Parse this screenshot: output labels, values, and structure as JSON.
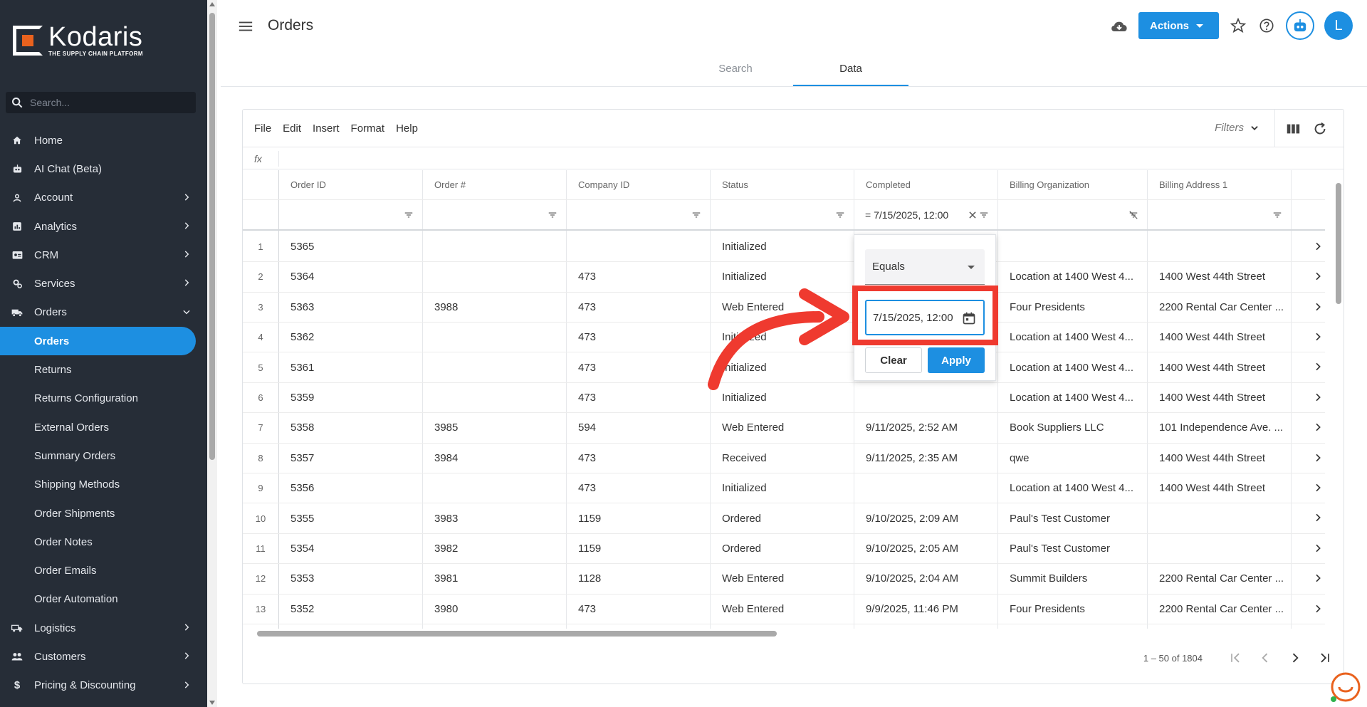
{
  "brand": {
    "name": "Kodaris",
    "tagline": "THE SUPPLY CHAIN PLATFORM"
  },
  "sidebar": {
    "search_placeholder": "Search...",
    "items": [
      {
        "label": "Home",
        "icon": "home-icon"
      },
      {
        "label": "AI Chat (Beta)",
        "icon": "robot-icon"
      },
      {
        "label": "Account",
        "icon": "person-icon",
        "expandable": true
      },
      {
        "label": "Analytics",
        "icon": "chart-icon",
        "expandable": true
      },
      {
        "label": "CRM",
        "icon": "id-card-icon",
        "expandable": true
      },
      {
        "label": "Services",
        "icon": "gears-icon",
        "expandable": true
      },
      {
        "label": "Orders",
        "icon": "truck-icon",
        "expanded": true
      }
    ],
    "sub_items": [
      "Orders",
      "Returns",
      "Returns Configuration",
      "External Orders",
      "Summary Orders",
      "Shipping Methods",
      "Order Shipments",
      "Order Notes",
      "Order Emails",
      "Order Automation"
    ],
    "active_sub": "Orders",
    "after_items": [
      {
        "label": "Logistics",
        "icon": "shipping-icon"
      },
      {
        "label": "Customers",
        "icon": "people-icon"
      },
      {
        "label": "Pricing & Discounting",
        "icon": "dollar-icon"
      }
    ]
  },
  "header": {
    "title": "Orders",
    "actions_label": "Actions",
    "avatar_letter": "L",
    "tabs": [
      {
        "label": "Search",
        "active": false
      },
      {
        "label": "Data",
        "active": true
      }
    ]
  },
  "toolbar": {
    "menus": [
      "File",
      "Edit",
      "Insert",
      "Format",
      "Help"
    ],
    "filters_label": "Filters",
    "fx_label": "fx"
  },
  "grid": {
    "columns": [
      "Order ID",
      "Order #",
      "Company ID",
      "Status",
      "Completed",
      "Billing Organization",
      "Billing Address 1"
    ],
    "completed_filter": "= 7/15/2025, 12:00",
    "rows": [
      {
        "n": "1",
        "id": "5365",
        "num": "",
        "company": "",
        "status": "Initialized",
        "completed": "",
        "org": "",
        "addr": ""
      },
      {
        "n": "2",
        "id": "5364",
        "num": "",
        "company": "473",
        "status": "Initialized",
        "completed": "",
        "org": "Location at 1400 West 4...",
        "addr": "1400 West 44th Street"
      },
      {
        "n": "3",
        "id": "5363",
        "num": "3988",
        "company": "473",
        "status": "Web Entered",
        "completed": "",
        "org": "Four Presidents",
        "addr": "2200 Rental Car Center ..."
      },
      {
        "n": "4",
        "id": "5362",
        "num": "",
        "company": "473",
        "status": "Initialized",
        "completed": "",
        "org": "Location at 1400 West 4...",
        "addr": "1400 West 44th Street"
      },
      {
        "n": "5",
        "id": "5361",
        "num": "",
        "company": "473",
        "status": "Initialized",
        "completed": "",
        "org": "Location at 1400 West 4...",
        "addr": "1400 West 44th Street"
      },
      {
        "n": "6",
        "id": "5359",
        "num": "",
        "company": "473",
        "status": "Initialized",
        "completed": "",
        "org": "Location at 1400 West 4...",
        "addr": "1400 West 44th Street"
      },
      {
        "n": "7",
        "id": "5358",
        "num": "3985",
        "company": "594",
        "status": "Web Entered",
        "completed": "9/11/2025, 2:52 AM",
        "org": "Book Suppliers LLC",
        "addr": "101 Independence Ave. ..."
      },
      {
        "n": "8",
        "id": "5357",
        "num": "3984",
        "company": "473",
        "status": "Received",
        "completed": "9/11/2025, 2:35 AM",
        "org": "qwe",
        "addr": "1400 West 44th Street"
      },
      {
        "n": "9",
        "id": "5356",
        "num": "",
        "company": "473",
        "status": "Initialized",
        "completed": "",
        "org": "Location at 1400 West 4...",
        "addr": "1400 West 44th Street"
      },
      {
        "n": "10",
        "id": "5355",
        "num": "3983",
        "company": "1159",
        "status": "Ordered",
        "completed": "9/10/2025, 2:09 AM",
        "org": "Paul's Test Customer",
        "addr": ""
      },
      {
        "n": "11",
        "id": "5354",
        "num": "3982",
        "company": "1159",
        "status": "Ordered",
        "completed": "9/10/2025, 2:05 AM",
        "org": "Paul's Test Customer",
        "addr": ""
      },
      {
        "n": "12",
        "id": "5353",
        "num": "3981",
        "company": "1128",
        "status": "Web Entered",
        "completed": "9/10/2025, 2:04 AM",
        "org": "Summit Builders",
        "addr": "2200 Rental Car Center ..."
      },
      {
        "n": "13",
        "id": "5352",
        "num": "3980",
        "company": "473",
        "status": "Web Entered",
        "completed": "9/9/2025, 11:46 PM",
        "org": "Four Presidents",
        "addr": "2200 Rental Car Center ..."
      }
    ]
  },
  "filter_popup": {
    "operator": "Equals",
    "value": "7/15/2025, 12:00",
    "clear_label": "Clear",
    "apply_label": "Apply"
  },
  "pager": {
    "range": "1 – 50 of 1804"
  },
  "colors": {
    "accent": "#1d8fe1",
    "sidebar_bg": "#262d37",
    "annotation_red": "#ef3a2f",
    "logo_orange": "#e9621e"
  }
}
